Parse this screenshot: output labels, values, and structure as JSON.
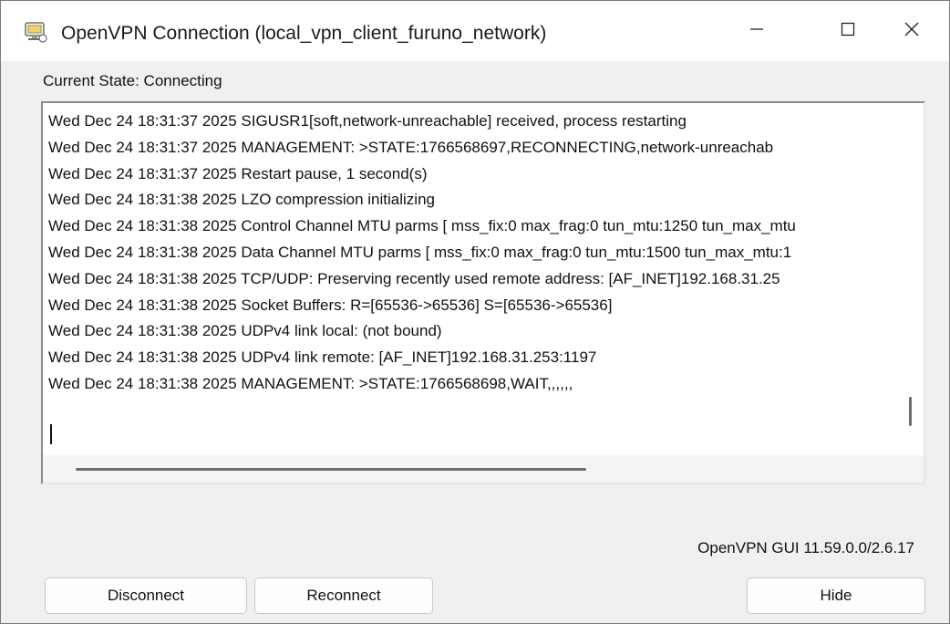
{
  "window": {
    "title": "OpenVPN Connection (local_vpn_client_furuno_network)",
    "icon": "openvpn-monitor-icon",
    "controls": {
      "minimize": "minimize-icon",
      "maximize": "maximize-icon",
      "close": "close-icon"
    }
  },
  "state": {
    "label": "Current State: Connecting"
  },
  "log": {
    "lines": [
      "Wed Dec 24 18:31:37 2025 SIGUSR1[soft,network-unreachable] received, process restarting",
      "Wed Dec 24 18:31:37 2025 MANAGEMENT: >STATE:1766568697,RECONNECTING,network-unreachab",
      "Wed Dec 24 18:31:37 2025 Restart pause, 1 second(s)",
      "Wed Dec 24 18:31:38 2025 LZO compression initializing",
      "Wed Dec 24 18:31:38 2025 Control Channel MTU parms [ mss_fix:0 max_frag:0 tun_mtu:1250 tun_max_mtu",
      "Wed Dec 24 18:31:38 2025 Data Channel MTU parms [ mss_fix:0 max_frag:0 tun_mtu:1500 tun_max_mtu:1",
      "Wed Dec 24 18:31:38 2025 TCP/UDP: Preserving recently used remote address: [AF_INET]192.168.31.25",
      "Wed Dec 24 18:31:38 2025 Socket Buffers: R=[65536->65536] S=[65536->65536]",
      "Wed Dec 24 18:31:38 2025 UDPv4 link local: (not bound)",
      "Wed Dec 24 18:31:38 2025 UDPv4 link remote: [AF_INET]192.168.31.253:1197",
      "Wed Dec 24 18:31:38 2025 MANAGEMENT: >STATE:1766568698,WAIT,,,,,,"
    ]
  },
  "footer": {
    "version": "OpenVPN GUI 11.59.0.0/2.6.17"
  },
  "buttons": {
    "disconnect": "Disconnect",
    "reconnect": "Reconnect",
    "hide": "Hide"
  }
}
